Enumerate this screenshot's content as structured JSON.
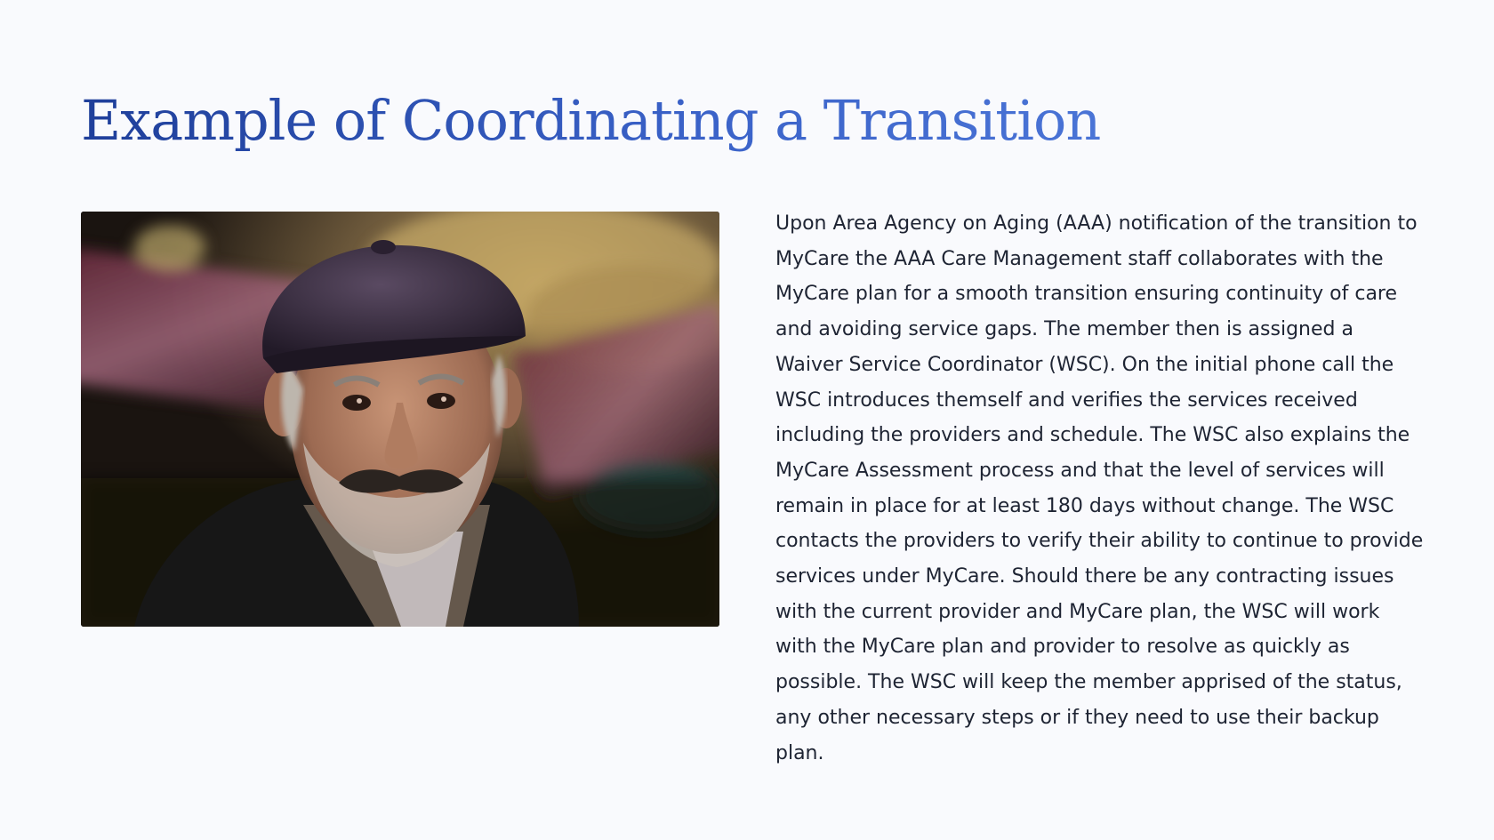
{
  "slide": {
    "title": "Example of Coordinating a Transition",
    "paragraph": "Upon Area Agency on Aging (AAA) notification of the transition to MyCare the AAA Care Management staff collaborates with the MyCare plan for a smooth transition ensuring continuity of care and avoiding service gaps. The member then is assigned a Waiver Service Coordinator (WSC). On the initial phone call the WSC introduces themself and verifies the services received including the providers and schedule. The WSC also explains the MyCare Assessment process and that the level of services will remain in place for at least 180 days without change. The WSC contacts the providers to verify their ability to continue to provide services under MyCare. Should there be any contracting issues with the current provider and MyCare plan, the WSC will work with the MyCare plan and provider to resolve as quickly as possible. The WSC will keep the member apprised of the status, any other necessary steps or if they need to use their backup plan."
  },
  "colors": {
    "background": "#f9fafd",
    "title_start": "#1f3f9a",
    "title_end": "#4a74d6",
    "body_text": "#1e2433"
  }
}
